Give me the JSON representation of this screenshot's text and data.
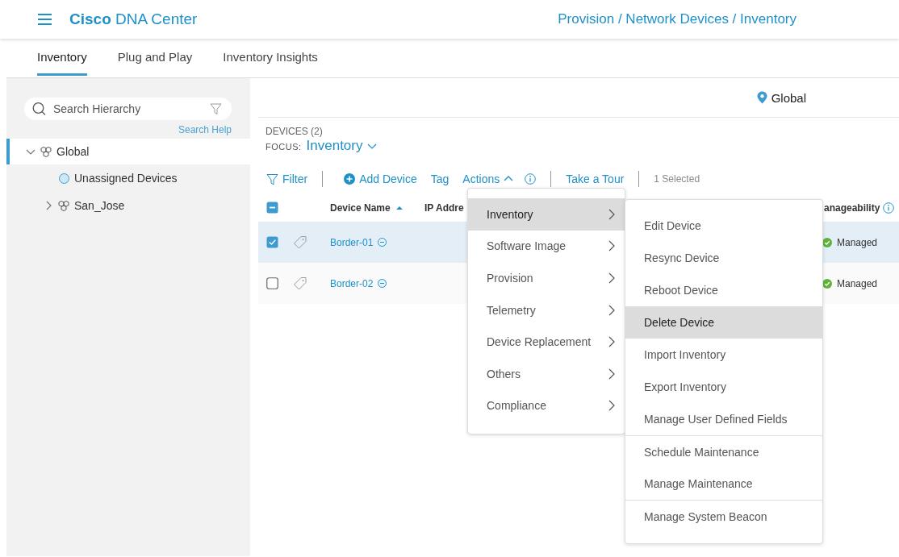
{
  "header": {
    "brand_bold": "Cisco",
    "brand": "DNA Center",
    "breadcrumb": "Provision / Network Devices / Inventory"
  },
  "tabs": [
    {
      "label": "Inventory",
      "selected": true
    },
    {
      "label": "Plug and Play",
      "selected": false
    },
    {
      "label": "Inventory Insights",
      "selected": false
    }
  ],
  "sidebar": {
    "search": {
      "placeholder": "Search Hierarchy"
    },
    "search_help": "Search Help",
    "tree": [
      {
        "label": "Global",
        "kind": "site",
        "expanded": true,
        "selected": true,
        "children": [
          {
            "label": "Unassigned Devices",
            "kind": "unassigned",
            "selected": false
          },
          {
            "label": "San_Jose",
            "kind": "site",
            "expanded": false,
            "selected": false
          }
        ]
      }
    ]
  },
  "location": "Global",
  "devices_count": "DEVICES (2)",
  "focus_label": "FOCUS:",
  "focus_value": "Inventory",
  "toolbar": {
    "filter": "Filter",
    "add_device": "Add Device",
    "tag": "Tag",
    "actions": "Actions",
    "actions_open": true,
    "take_tour": "Take a Tour",
    "selection": "1 Selected"
  },
  "table": {
    "select_all_partial": true,
    "columns": [
      {
        "label": "Device Name",
        "sorted": true,
        "info": false
      },
      {
        "label": "IP Addre"
      },
      {
        "label": "anageability",
        "sorted": false,
        "info": true
      }
    ],
    "rows": [
      {
        "name": "Border-01",
        "selected": true,
        "manageability": "Managed"
      },
      {
        "name": "Border-02",
        "selected": false,
        "manageability": "Managed"
      }
    ]
  },
  "actions_menu": {
    "items": [
      {
        "label": "Inventory",
        "selected": true
      },
      {
        "label": "Software Image",
        "selected": false
      },
      {
        "label": "Provision",
        "selected": false
      },
      {
        "label": "Telemetry",
        "selected": false
      },
      {
        "label": "Device Replacement",
        "selected": false
      },
      {
        "label": "Others",
        "selected": false
      },
      {
        "label": "Compliance",
        "selected": false
      }
    ],
    "submenu": [
      {
        "label": "Edit Device",
        "selected": false,
        "divider_above": false
      },
      {
        "label": "Resync Device",
        "selected": false,
        "divider_above": false
      },
      {
        "label": "Reboot Device",
        "selected": false,
        "divider_above": false
      },
      {
        "label": "Delete Device",
        "selected": true,
        "divider_above": false
      },
      {
        "label": "Import Inventory",
        "selected": false,
        "divider_above": false
      },
      {
        "label": "Export Inventory",
        "selected": false,
        "divider_above": false
      },
      {
        "label": "Manage User Defined Fields",
        "selected": false,
        "divider_above": false
      },
      {
        "label": "Schedule Maintenance",
        "selected": false,
        "divider_above": true
      },
      {
        "label": "Manage Maintenance",
        "selected": false,
        "divider_above": false
      },
      {
        "label": "Manage System Beacon",
        "selected": false,
        "divider_above": true
      }
    ]
  }
}
